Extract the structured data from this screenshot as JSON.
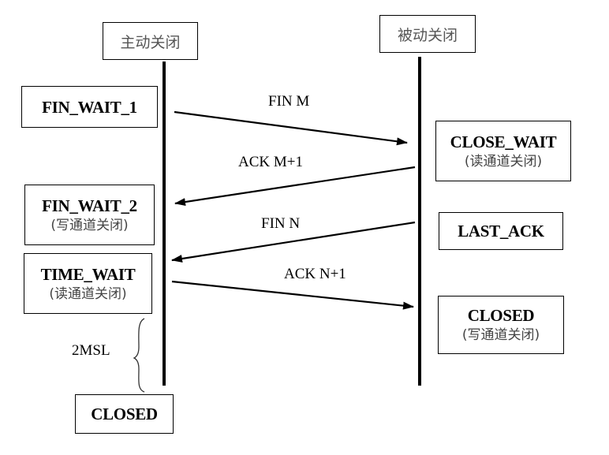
{
  "participants": {
    "active": "主动关闭",
    "passive": "被动关闭"
  },
  "active_states": [
    {
      "name": "FIN_WAIT_1",
      "note": ""
    },
    {
      "name": "FIN_WAIT_2",
      "note": "(写通道关闭)"
    },
    {
      "name": "TIME_WAIT",
      "note": "(读通道关闭)"
    },
    {
      "name": "CLOSED",
      "note": ""
    }
  ],
  "passive_states": [
    {
      "name": "CLOSE_WAIT",
      "note": "(读通道关闭)"
    },
    {
      "name": "LAST_ACK",
      "note": ""
    },
    {
      "name": "CLOSED",
      "note": "(写通道关闭)"
    }
  ],
  "messages": [
    {
      "label": "FIN M",
      "direction": "active-to-passive"
    },
    {
      "label": "ACK M+1",
      "direction": "passive-to-active"
    },
    {
      "label": "FIN N",
      "direction": "passive-to-active"
    },
    {
      "label": "ACK N+1",
      "direction": "active-to-passive"
    }
  ],
  "timer": {
    "label": "2MSL"
  }
}
